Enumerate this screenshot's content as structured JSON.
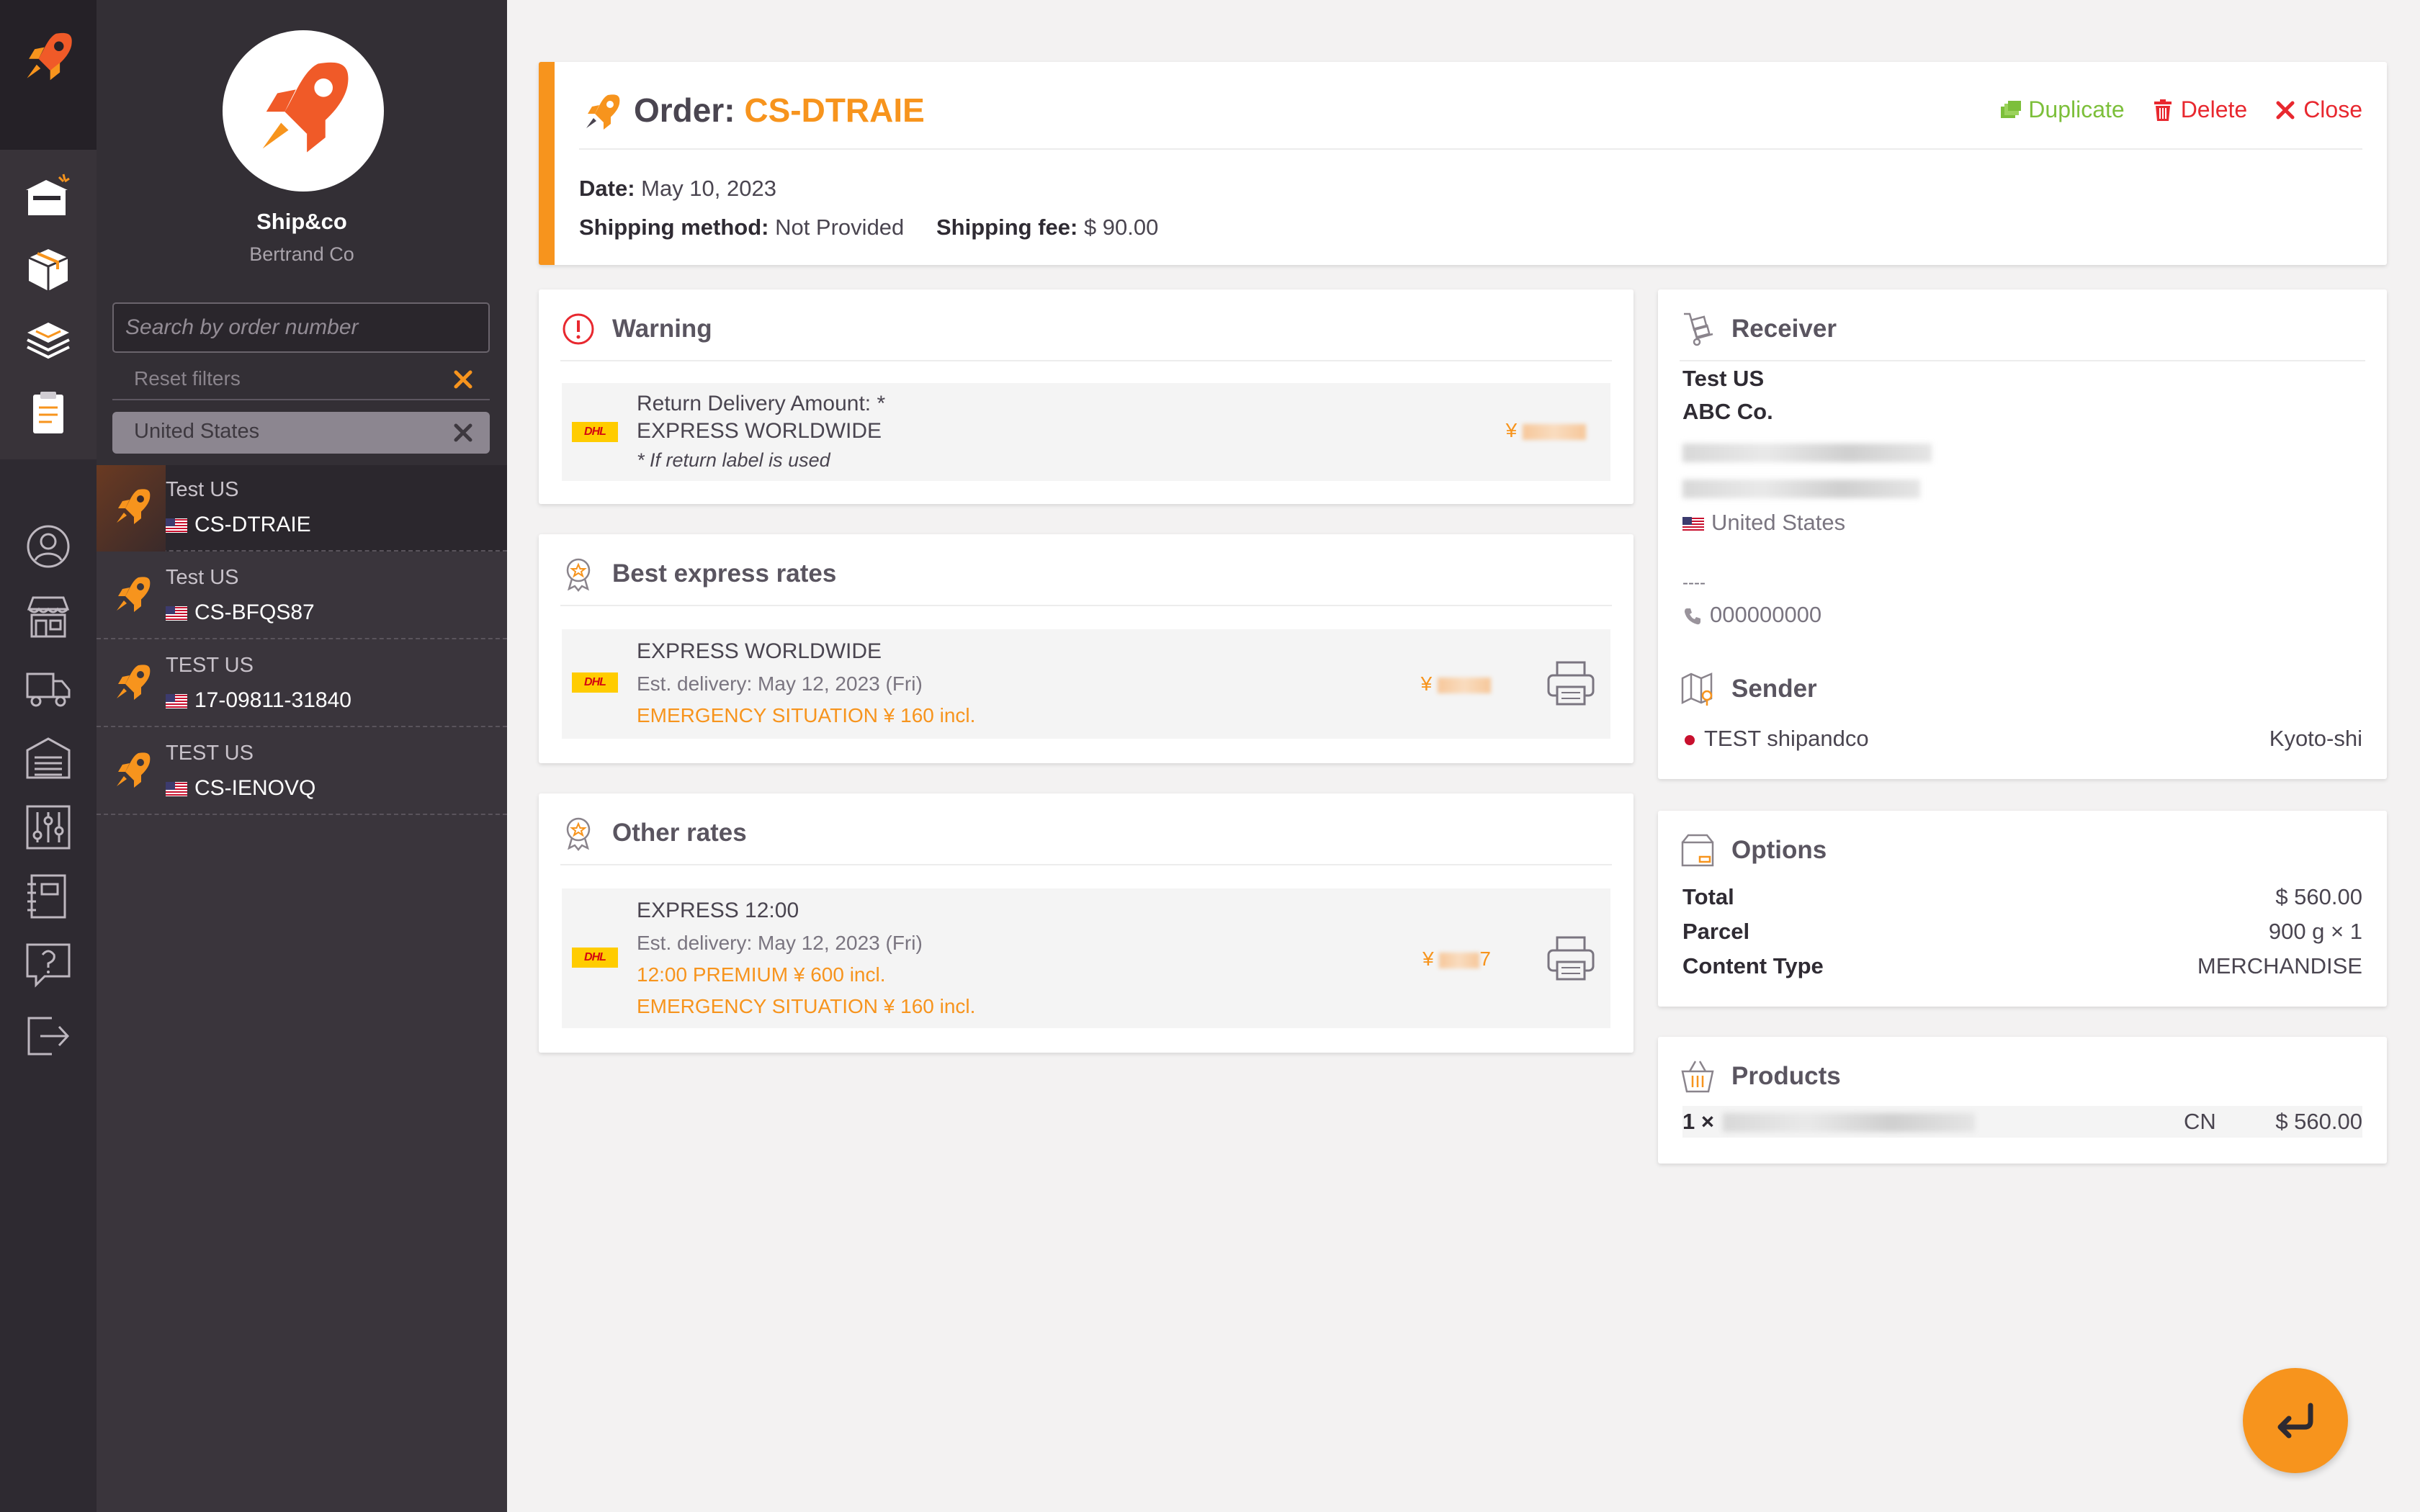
{
  "brand": {
    "accent": "#f7941d",
    "danger": "#e8282f",
    "success": "#7cbf3a"
  },
  "sidebar": {
    "company_name": "Ship&co",
    "company_sub": "Bertrand Co",
    "search_placeholder": "Search by order number",
    "reset_filters": "Reset filters",
    "country_filter": "United States",
    "orders": [
      {
        "name": "Test US",
        "id": "CS-DTRAIE",
        "active": true
      },
      {
        "name": "Test US",
        "id": "CS-BFQS87",
        "active": false
      },
      {
        "name": "TEST US",
        "id": "17-09811-31840",
        "active": false
      },
      {
        "name": "TEST US",
        "id": "CS-IENOVQ",
        "active": false
      }
    ]
  },
  "rail": {
    "icons": [
      "orders-new-icon",
      "box-icon",
      "layers-icon",
      "clipboard-icon",
      "user-icon",
      "store-icon",
      "truck-icon",
      "warehouse-icon",
      "sliders-icon",
      "notebook-icon",
      "help-icon",
      "logout-icon"
    ]
  },
  "order": {
    "title_prefix": "Order: ",
    "number": "CS-DTRAIE",
    "actions": {
      "duplicate": "Duplicate",
      "delete": "Delete",
      "close": "Close"
    },
    "date_label": "Date:",
    "date_value": " May 10, 2023",
    "method_label": "Shipping method:",
    "method_value": " Not Provided",
    "fee_label": "Shipping fee:",
    "fee_value": " $ 90.00"
  },
  "warning": {
    "title": "Warning",
    "line1": "Return Delivery Amount: *",
    "line2": "EXPRESS WORLDWIDE",
    "line3": "* If return label is used",
    "price_symbol": "¥"
  },
  "best_rates": {
    "title": "Best express rates",
    "service": "EXPRESS WORLDWIDE",
    "delivery": "Est. delivery: May 12, 2023 (Fri)",
    "surcharge": "EMERGENCY SITUATION ¥ 160 incl.",
    "price_symbol": "¥"
  },
  "other_rates": {
    "title": "Other rates",
    "service": "EXPRESS 12:00",
    "delivery": "Est. delivery: May 12, 2023 (Fri)",
    "surcharge1": "12:00 PREMIUM ¥ 600 incl.",
    "surcharge2": "EMERGENCY SITUATION ¥ 160 incl.",
    "price_symbol": "¥",
    "price_suffix": "7"
  },
  "receiver": {
    "title": "Receiver",
    "name": "Test US",
    "company": "ABC Co.",
    "country": "United States",
    "dashes": "----",
    "phone": "000000000"
  },
  "sender": {
    "title": "Sender",
    "name": "TEST shipandco",
    "city": "Kyoto-shi"
  },
  "options": {
    "title": "Options",
    "rows": [
      {
        "label": "Total",
        "value": "$ 560.00"
      },
      {
        "label": "Parcel",
        "value": "900 g × 1"
      },
      {
        "label": "Content Type",
        "value": "MERCHANDISE"
      }
    ]
  },
  "products": {
    "title": "Products",
    "qty": "1 ×",
    "origin": "CN",
    "price": "$ 560.00"
  }
}
